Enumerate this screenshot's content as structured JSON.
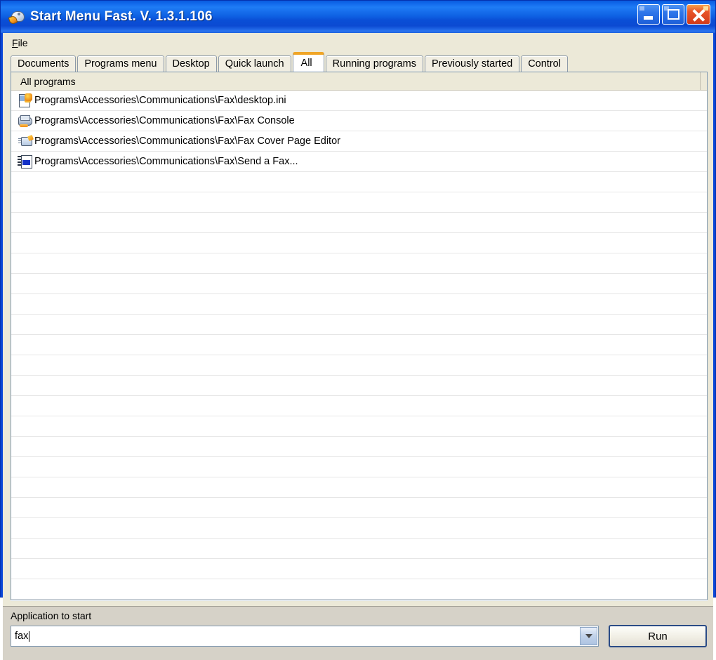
{
  "window": {
    "title": "Start Menu Fast. V. 1.3.1.106",
    "icon": "app-icon",
    "buttons": {
      "minimize": "minimize-button",
      "maximize": "maximize-button",
      "close": "close-button"
    }
  },
  "menubar": {
    "items": [
      {
        "label": "File",
        "accesskey": "F"
      }
    ]
  },
  "tabs": [
    {
      "label": "Documents",
      "active": false
    },
    {
      "label": "Programs menu",
      "active": false
    },
    {
      "label": "Desktop",
      "active": false
    },
    {
      "label": "Quick launch",
      "active": false
    },
    {
      "label": "All",
      "active": true
    },
    {
      "label": "Running programs",
      "active": false
    },
    {
      "label": "Previously started",
      "active": false
    },
    {
      "label": "Control",
      "active": false
    }
  ],
  "list": {
    "header": "All programs",
    "rows": [
      {
        "icon": "ini-file-icon",
        "path": "Programs\\Accessories\\Communications\\Fax\\desktop.ini"
      },
      {
        "icon": "fax-console-icon",
        "path": "Programs\\Accessories\\Communications\\Fax\\Fax Console"
      },
      {
        "icon": "fax-cover-page-editor-icon",
        "path": "Programs\\Accessories\\Communications\\Fax\\Fax Cover Page Editor"
      },
      {
        "icon": "send-a-fax-icon",
        "path": "Programs\\Accessories\\Communications\\Fax\\Send a Fax..."
      }
    ],
    "empty_row_count": 21
  },
  "bottom": {
    "label": "Application to start",
    "input_value": "fax",
    "input_placeholder": "",
    "dropdown_icon": "chevron-down-icon",
    "run_label": "Run"
  },
  "colors": {
    "titlebar_blue": "#0e60e3",
    "active_tab_accent": "#f0a526",
    "face": "#ece9d8",
    "bottom_face": "#d6d2c8",
    "close_button": "#e8552a"
  }
}
